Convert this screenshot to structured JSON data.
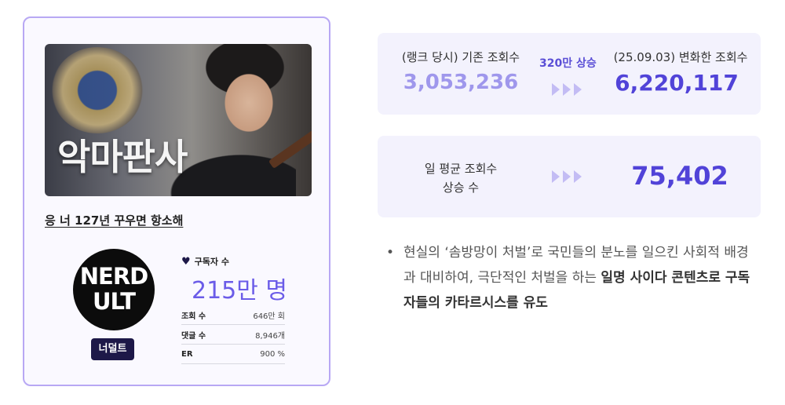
{
  "card": {
    "thumbnail_text": "악마판사",
    "video_title": "응 너 127년 꾸우면 항소해",
    "logo_line1": "NERD",
    "logo_line2": "ULT",
    "channel_name": "너덜트",
    "subscribers_label": "구독자 수",
    "subscribers_value": "215만 명",
    "stats": [
      {
        "key": "조회 수",
        "value": "646만 회"
      },
      {
        "key": "댓글 수",
        "value": "8,946개"
      },
      {
        "key": "ER",
        "value": "900 %"
      }
    ]
  },
  "views_panel": {
    "before_label": "(랭크 당시) 기존 조회수",
    "before_value": "3,053,236",
    "increase_label": "320만 상승",
    "after_label": "(25.09.03) 변화한 조회수",
    "after_value": "6,220,117"
  },
  "daily_panel": {
    "label_line1": "일 평균 조회수",
    "label_line2": "상승 수",
    "value": "75,402"
  },
  "bullet": {
    "dot": "•",
    "text_plain": "현실의 ‘솜방망이 처벌’로 국민들의 분노를 일으킨 사회적 배경과 대비하여, 극단적인 처벌을 하는 ",
    "text_bold": "일명 사이다 콘텐츠로 구독자들의 카타르시스를 유도"
  },
  "colors": {
    "accent": "#6b5ce8",
    "before_value": "#9f97ec",
    "after_value": "#5143d8",
    "badge_bg": "#1d1848",
    "card_border": "#b8a8f4",
    "panel_bg": "#f3f2fd"
  },
  "icons": {
    "heart": "heart-icon",
    "arrow": "triangle-right-icon"
  }
}
